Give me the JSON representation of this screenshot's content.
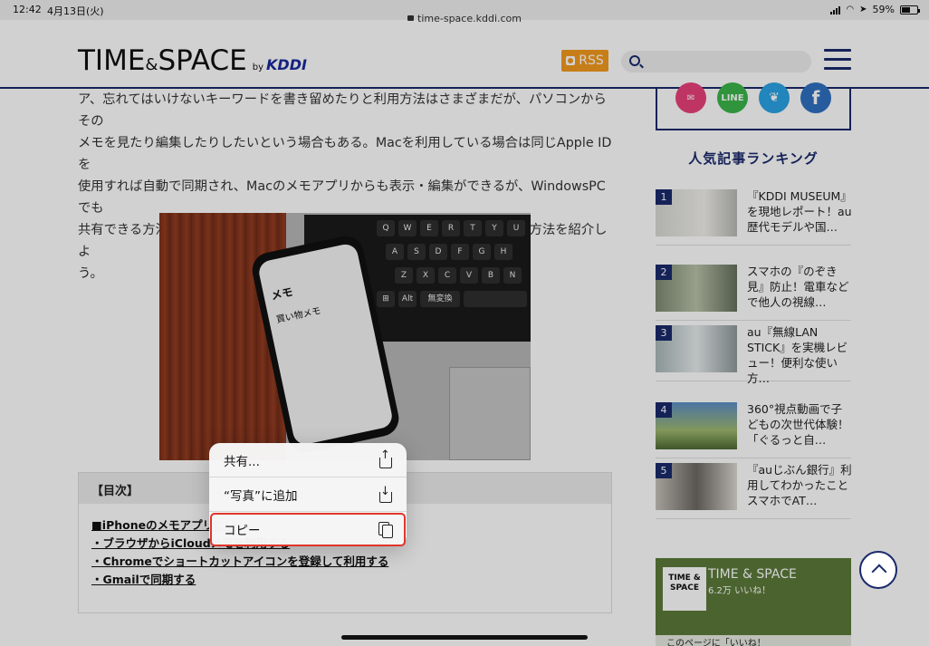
{
  "status": {
    "time": "12:42",
    "date": "4月13日(火)",
    "battery": "59%",
    "battery_level": 0.59
  },
  "browser": {
    "url": "time-space.kddi.com"
  },
  "header": {
    "logo_main": "TIME",
    "logo_amp": "&",
    "logo_main2": "SPACE",
    "logo_by": "by",
    "logo_kddi": "KDDI",
    "rss_label": "RSS",
    "search_placeholder": ""
  },
  "article": {
    "lines": [
      "ア、忘れてはいけないキーワードを書き留めたりと利用方法はさまざまだが、パソコンからその",
      "メモを見たり編集したりしたいという場合もある。Macを利用している場合は同じApple IDを",
      "使用すれば自動で同期され、Macのメモアプリからも表示・編集ができるが、WindowsPCでも",
      "共有できる方法をご存知だろうか。実は意外と簡単な方法で共有できる、その方法を紹介しよ",
      "う。"
    ],
    "phone_title": "メモ",
    "phone_note": "買い物メモ"
  },
  "toc": {
    "title": "【目次】",
    "items": [
      "■iPhoneのメモアプリにい",
      "・ブラウザからiCloudメモを利用する",
      "・Chromeでショートカットアイコンを登録して利用する",
      "・Gmailで同期する"
    ]
  },
  "context_menu": {
    "items": [
      {
        "label": "共有...",
        "icon": "share-icon"
      },
      {
        "label": "“写真”に追加",
        "icon": "add-to-photos-icon"
      },
      {
        "label": "コピー",
        "icon": "copy-icon"
      }
    ]
  },
  "sidebar": {
    "social": [
      {
        "label": "",
        "color": "#e8417a"
      },
      {
        "label": "LINE",
        "color": "#3ab54a"
      },
      {
        "label": "",
        "color": "#2aa3e4"
      },
      {
        "label": "f",
        "color": "#2f6fc1"
      }
    ],
    "ranking_title": "人気記事ランキング",
    "ranking": [
      {
        "rank": "1",
        "text": "『KDDI MUSEUM』を現地レポート！au歴代モデルや国…"
      },
      {
        "rank": "2",
        "text": "スマホの『のぞき見』防止！電車などで他人の視線…"
      },
      {
        "rank": "3",
        "text": "au『無線LAN STICK』を実機レビュー！便利な使い方…"
      },
      {
        "rank": "4",
        "text": "360°視点動画で子どもの次世代体験！「ぐるっと自…"
      },
      {
        "rank": "5",
        "text": "『auじぶん銀行』利用してわかったことスマホでAT…"
      }
    ],
    "facebook": {
      "logo_text": "TIME & SPACE",
      "name": "TIME & SPACE",
      "likes": "6.2万 いいね！",
      "bottom": "このページに「いいね！"
    }
  },
  "colors": {
    "brand_navy": "#1a2a6c",
    "rss_orange": "#f39a1e",
    "highlight_red": "#e0352b"
  }
}
